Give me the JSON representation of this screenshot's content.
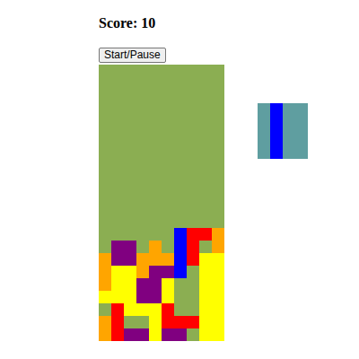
{
  "score": "Score: 10",
  "button": "Start/Pause",
  "board": {
    "rows": [
      [
        null,
        null,
        null,
        null,
        null,
        null,
        null,
        null,
        null,
        null
      ],
      [
        null,
        null,
        null,
        null,
        null,
        null,
        null,
        null,
        null,
        null
      ],
      [
        null,
        null,
        null,
        null,
        null,
        null,
        null,
        null,
        null,
        null
      ],
      [
        null,
        null,
        null,
        null,
        null,
        null,
        null,
        null,
        null,
        null
      ],
      [
        null,
        null,
        null,
        null,
        null,
        null,
        null,
        null,
        null,
        null
      ],
      [
        null,
        null,
        null,
        null,
        null,
        null,
        null,
        null,
        null,
        null
      ],
      [
        null,
        null,
        null,
        null,
        null,
        null,
        null,
        null,
        null,
        null
      ],
      [
        null,
        null,
        null,
        null,
        null,
        null,
        null,
        null,
        null,
        null
      ],
      [
        null,
        null,
        null,
        null,
        null,
        null,
        null,
        null,
        null,
        null
      ],
      [
        null,
        null,
        null,
        null,
        null,
        null,
        null,
        null,
        null,
        null
      ],
      [
        null,
        null,
        null,
        null,
        null,
        null,
        null,
        null,
        null,
        null
      ],
      [
        null,
        null,
        null,
        null,
        null,
        null,
        null,
        null,
        null,
        null
      ],
      [
        null,
        null,
        null,
        null,
        null,
        null,
        null,
        null,
        null,
        null
      ],
      [
        null,
        null,
        null,
        null,
        null,
        null,
        "#0000ff",
        "#ff0000",
        "#ff0000",
        "#ffa500"
      ],
      [
        null,
        "#800080",
        "#800080",
        null,
        "#ffa500",
        null,
        "#0000ff",
        "#ff0000",
        null,
        "#ffa500"
      ],
      [
        "#ffa500",
        "#800080",
        "#800080",
        "#ffa500",
        "#ffa500",
        "#ffa500",
        "#0000ff",
        "#ff0000",
        "#ffff00",
        "#ffff00"
      ],
      [
        "#ffa500",
        "#ffff00",
        "#ffff00",
        "#ffa500",
        "#800080",
        "#800080",
        "#0000ff",
        null,
        "#ffff00",
        "#ffff00"
      ],
      [
        "#ffa500",
        "#ffff00",
        "#ffff00",
        "#800080",
        "#800080",
        "#ffff00",
        null,
        null,
        "#ffff00",
        "#ffff00"
      ],
      [
        "#ffff00",
        "#ffff00",
        "#ffff00",
        "#800080",
        "#800080",
        "#ffff00",
        null,
        null,
        "#ffff00",
        "#ffff00"
      ],
      [
        null,
        "#ff0000",
        "#ffff00",
        "#ffff00",
        "#ffff00",
        "#ff0000",
        null,
        null,
        "#ffff00",
        "#ffff00"
      ],
      [
        "#ffa500",
        "#ff0000",
        null,
        null,
        "#ffff00",
        "#ff0000",
        "#ff0000",
        "#ff0000",
        "#ffff00",
        "#ffff00"
      ],
      [
        "#ffa500",
        "#ff0000",
        "#800080",
        "#800080",
        "#ffff00",
        "#800080",
        "#800080",
        null,
        "#ffff00",
        "#ffff00"
      ]
    ]
  },
  "next": {
    "rows": [
      [
        null,
        "#0000ff",
        null,
        null
      ],
      [
        null,
        "#0000ff",
        null,
        null
      ],
      [
        null,
        "#0000ff",
        null,
        null
      ],
      [
        null,
        "#0000ff",
        null,
        null
      ]
    ]
  }
}
